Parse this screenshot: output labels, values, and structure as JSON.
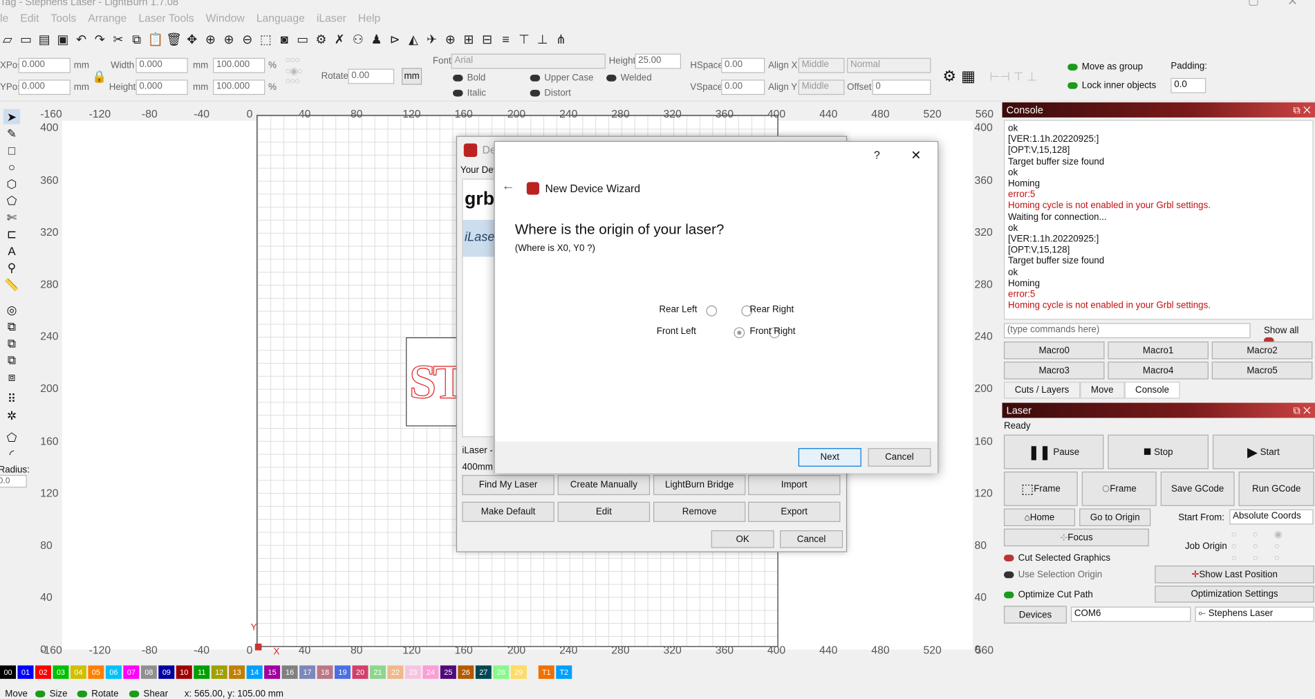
{
  "window": {
    "title": "Tag - Stephens Laser - LightBurn 1.7.08"
  },
  "menu": [
    "le",
    "Edit",
    "Tools",
    "Arrange",
    "Laser Tools",
    "Window",
    "Language",
    "iLaser",
    "Help"
  ],
  "props": {
    "xpos_label": "XPos",
    "xpos": "0.000",
    "ypos_label": "YPos",
    "ypos": "0.000",
    "unit": "mm",
    "width_label": "Width",
    "width": "0.000",
    "height_label": "Height",
    "height": "0.000",
    "pct1": "100.000",
    "pct2": "100.000",
    "pct_unit": "%",
    "rotate_label": "Rotate",
    "rotate": "0.00",
    "mm_btn": "mm",
    "font_label": "Font",
    "font": "Arial",
    "height2_label": "Height",
    "height2": "25.00",
    "hspace_label": "HSpace",
    "hspace": "0.00",
    "vspace_label": "VSpace",
    "vspace": "0.00",
    "alignx_label": "Align X",
    "alignx": "Middle",
    "aligny_label": "Align Y",
    "aligny": "Middle",
    "normal": "Normal",
    "offset_label": "Offset",
    "offset": "0",
    "bold": "Bold",
    "italic": "Italic",
    "upper": "Upper Case",
    "distort": "Distort",
    "welded": "Welded",
    "move_group": "Move as group",
    "lock_inner": "Lock inner objects",
    "padding_label": "Padding:",
    "padding": "0.0"
  },
  "rulers": {
    "top": [
      "-160",
      "-120",
      "-80",
      "-40",
      "0",
      "40",
      "80",
      "120",
      "160",
      "200",
      "240",
      "280",
      "320",
      "360",
      "400",
      "440",
      "480",
      "520",
      "560"
    ],
    "left": [
      "400",
      "360",
      "320",
      "280",
      "240",
      "200",
      "160",
      "120",
      "80",
      "40",
      "0"
    ]
  },
  "canvas_text": {
    "y": "Y",
    "x": "X",
    "tag": "STE"
  },
  "left_tools": {
    "radius_label": "Radius:",
    "radius": "0.0"
  },
  "palette": [
    {
      "n": "00",
      "c": "#000000"
    },
    {
      "n": "01",
      "c": "#0000ff"
    },
    {
      "n": "02",
      "c": "#ff0000"
    },
    {
      "n": "03",
      "c": "#00c000"
    },
    {
      "n": "04",
      "c": "#d0c000"
    },
    {
      "n": "05",
      "c": "#ff8000"
    },
    {
      "n": "06",
      "c": "#00c0ff"
    },
    {
      "n": "07",
      "c": "#ff00ff"
    },
    {
      "n": "08",
      "c": "#909090"
    },
    {
      "n": "09",
      "c": "#0000a0"
    },
    {
      "n": "10",
      "c": "#a00000"
    },
    {
      "n": "11",
      "c": "#00a000"
    },
    {
      "n": "12",
      "c": "#a0a000"
    },
    {
      "n": "13",
      "c": "#c08000"
    },
    {
      "n": "14",
      "c": "#00a0ff"
    },
    {
      "n": "15",
      "c": "#a000a0"
    },
    {
      "n": "16",
      "c": "#808080"
    },
    {
      "n": "17",
      "c": "#7d87b9"
    },
    {
      "n": "18",
      "c": "#bb7784"
    },
    {
      "n": "19",
      "c": "#4a6fe3"
    },
    {
      "n": "20",
      "c": "#d33f6a"
    },
    {
      "n": "21",
      "c": "#8cd78c"
    },
    {
      "n": "22",
      "c": "#f0b98d"
    },
    {
      "n": "23",
      "c": "#f6c4e1"
    },
    {
      "n": "24",
      "c": "#fa9ed4"
    },
    {
      "n": "25",
      "c": "#500a78"
    },
    {
      "n": "26",
      "c": "#b45a00"
    },
    {
      "n": "27",
      "c": "#004754"
    },
    {
      "n": "28",
      "c": "#86fa88"
    },
    {
      "n": "29",
      "c": "#ffdb66"
    },
    {
      "n": "T1",
      "c": "#f07000"
    },
    {
      "n": "T2",
      "c": "#00a0ff"
    }
  ],
  "status": {
    "move": "Move",
    "size": "Size",
    "rotate": "Rotate",
    "shear": "Shear",
    "coords": "x: 565.00, y: 105.00 mm"
  },
  "console": {
    "title": "Console",
    "lines": [
      {
        "t": "ok",
        "e": false
      },
      {
        "t": "[VER:1.1h.20220925:]",
        "e": false
      },
      {
        "t": "[OPT:V,15,128]",
        "e": false
      },
      {
        "t": "Target buffer size found",
        "e": false
      },
      {
        "t": "ok",
        "e": false
      },
      {
        "t": "Homing",
        "e": false
      },
      {
        "t": "error:5",
        "e": true
      },
      {
        "t": "Homing cycle is not enabled in your Grbl settings.",
        "e": true
      },
      {
        "t": "Waiting for connection...",
        "e": false
      },
      {
        "t": "ok",
        "e": false
      },
      {
        "t": "[VER:1.1h.20220925:]",
        "e": false
      },
      {
        "t": "[OPT:V,15,128]",
        "e": false
      },
      {
        "t": "Target buffer size found",
        "e": false
      },
      {
        "t": "ok",
        "e": false
      },
      {
        "t": "Homing",
        "e": false
      },
      {
        "t": "error:5",
        "e": true
      },
      {
        "t": "Homing cycle is not enabled in your Grbl settings.",
        "e": true
      }
    ],
    "placeholder": "(type commands here)",
    "show_all": "Show all",
    "macros": [
      "Macro0",
      "Macro1",
      "Macro2",
      "Macro3",
      "Macro4",
      "Macro5"
    ],
    "tabs": [
      "Cuts / Layers",
      "Move",
      "Console"
    ]
  },
  "laser": {
    "title": "Laser",
    "state": "Ready",
    "pause": "Pause",
    "stop": "Stop",
    "start": "Start",
    "frame1": "Frame",
    "frame2": "Frame",
    "save_gcode": "Save GCode",
    "run_gcode": "Run GCode",
    "home": "Home",
    "go_origin": "Go to Origin",
    "start_from_label": "Start From:",
    "start_from": "Absolute Coords",
    "focus": "Focus",
    "job_origin": "Job Origin",
    "cut_selected": "Cut Selected Graphics",
    "use_sel_origin": "Use Selection Origin",
    "optimize": "Optimize Cut Path",
    "show_last": "Show Last Position",
    "opt_settings": "Optimization Settings",
    "devices": "Devices",
    "port": "COM6",
    "device": "Stephens Laser"
  },
  "devices_dialog": {
    "title": "De",
    "your_dev": "Your Dev",
    "item1": "grbl",
    "item2": "iLase",
    "info1": "iLaser -",
    "info2": "400mm",
    "find": "Find My Laser",
    "create": "Create Manually",
    "bridge": "LightBurn Bridge",
    "import": "Import",
    "make_default": "Make Default",
    "edit": "Edit",
    "remove": "Remove",
    "export": "Export",
    "ok": "OK",
    "cancel": "Cancel"
  },
  "wizard": {
    "help": "?",
    "close": "✕",
    "title": "New Device Wizard",
    "question": "Where is the origin of your laser?",
    "sub": "(Where is X0, Y0 ?)",
    "rear_left": "Rear Left",
    "rear_right": "Rear Right",
    "front_left": "Front Left",
    "front_right": "Front Right",
    "selected": "Front Left",
    "next": "Next",
    "cancel": "Cancel"
  },
  "colors": {
    "accent": "#7a1a1a",
    "error": "#c41010",
    "toggle_on": "#1a9b1a"
  }
}
